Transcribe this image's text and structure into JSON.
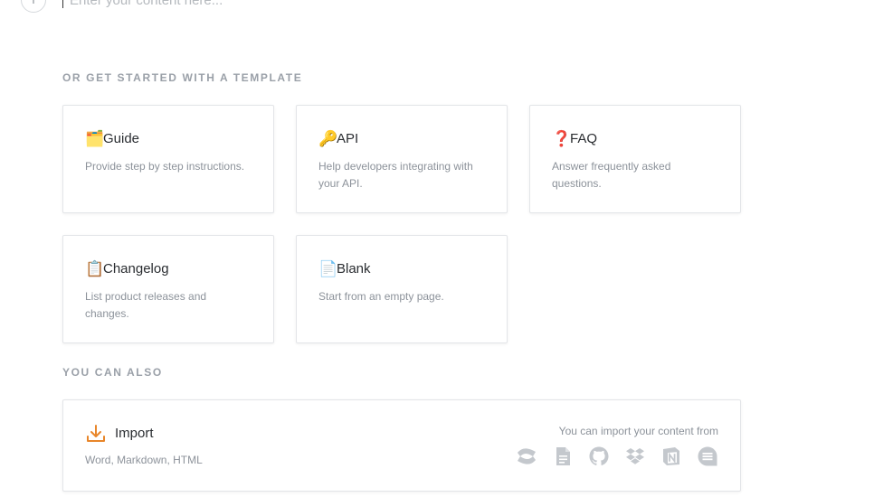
{
  "editor": {
    "placeholder": "Enter your content here...",
    "add_icon": "plus-icon"
  },
  "templates_section": {
    "title": "OR GET STARTED WITH A TEMPLATE",
    "cards": [
      {
        "emoji": "🗂️",
        "title": "Guide",
        "description": "Provide step by step instructions."
      },
      {
        "emoji": "🔑",
        "title": "API",
        "description": "Help developers integrating with your API."
      },
      {
        "emoji": "❓",
        "title": "FAQ",
        "description": "Answer frequently asked questions."
      },
      {
        "emoji": "📋",
        "title": "Changelog",
        "description": "List product releases and changes."
      },
      {
        "emoji": "📄",
        "title": "Blank",
        "description": "Start from an empty page."
      }
    ]
  },
  "also_section": {
    "title": "YOU CAN ALSO",
    "import": {
      "title": "Import",
      "description": "Word, Markdown, HTML",
      "hint": "You can import your content from",
      "icon": "download-icon",
      "sources": [
        "confluence-icon",
        "document-icon",
        "github-icon",
        "dropbox-icon",
        "notion-icon",
        "quip-icon"
      ]
    }
  },
  "colors": {
    "accent": "#e8862a",
    "muted_icon": "#c4c8cd",
    "section_title": "#9aa0a8"
  }
}
